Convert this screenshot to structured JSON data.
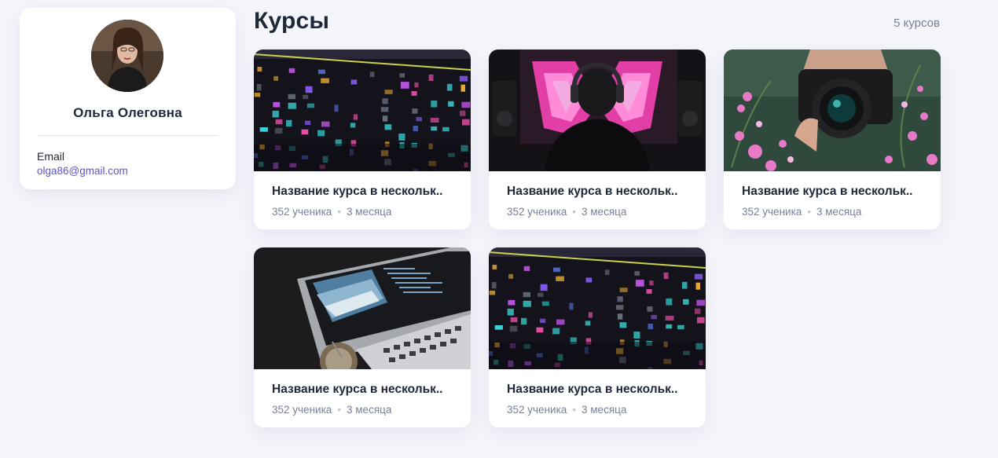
{
  "profile": {
    "name": "Ольга Олеговна",
    "email_label": "Email",
    "email": "olga86@gmail.com"
  },
  "courses_header": {
    "title": "Курсы",
    "count": "5 курсов"
  },
  "courses": [
    {
      "title": "Название курса в нескольк..",
      "students": "352 ученика",
      "duration": "3 месяца",
      "image": "editing-timeline"
    },
    {
      "title": "Название курса в нескольк..",
      "students": "352 ученика",
      "duration": "3 месяца",
      "image": "dj-headphones"
    },
    {
      "title": "Название курса в нескольк..",
      "students": "352 ученика",
      "duration": "3 месяца",
      "image": "camera-flowers"
    },
    {
      "title": "Название курса в нескольк..",
      "students": "352 ученика",
      "duration": "3 месяца",
      "image": "laptop-code"
    },
    {
      "title": "Название курса в нескольк..",
      "students": "352 ученика",
      "duration": "3 месяца",
      "image": "editing-timeline"
    }
  ],
  "colors": {
    "background": "#f5f5fc",
    "link": "#5a56c8",
    "text": "#1e2838",
    "muted": "#77809a"
  }
}
